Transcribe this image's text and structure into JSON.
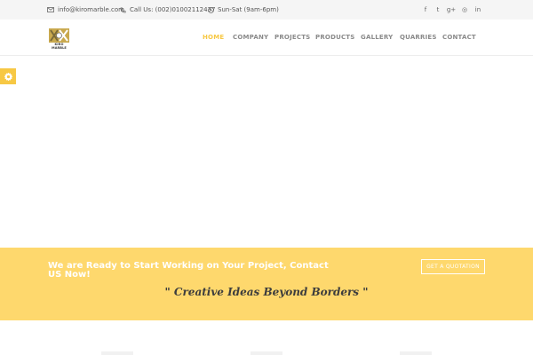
{
  "topbar": {
    "email": "info@kiromarble.com",
    "phone": "Call Us: (002)01002112437",
    "hours": "Sun-Sat (9am-6pm)",
    "social": [
      {
        "icon": "facebook-icon",
        "glyph": "f"
      },
      {
        "icon": "twitter-icon",
        "glyph": "t"
      },
      {
        "icon": "google-plus-icon",
        "glyph": "g+"
      },
      {
        "icon": "instagram-icon",
        "glyph": "◎"
      },
      {
        "icon": "linkedin-icon",
        "glyph": "in"
      }
    ]
  },
  "header": {
    "logo_text": "KIRO MARBLE",
    "nav": [
      {
        "label": "HOME",
        "active": true
      },
      {
        "label": "COMPANY",
        "active": false
      },
      {
        "label": "PROJECTS",
        "active": false
      },
      {
        "label": "PRODUCTS",
        "active": false
      },
      {
        "label": "GALLERY",
        "active": false
      },
      {
        "label": "QUARRIES",
        "active": false
      },
      {
        "label": "CONTACT",
        "active": false
      }
    ]
  },
  "banner": {
    "heading": "We are Ready to Start Working on Your Project, Contact US Now!",
    "button_label": "GET A QUOTATION",
    "tagline": "\" Creative Ideas Beyond Borders \""
  },
  "colors": {
    "accent": "#f7c844",
    "banner_bg": "#fed86d",
    "topbar_bg": "#f5f5f5"
  }
}
